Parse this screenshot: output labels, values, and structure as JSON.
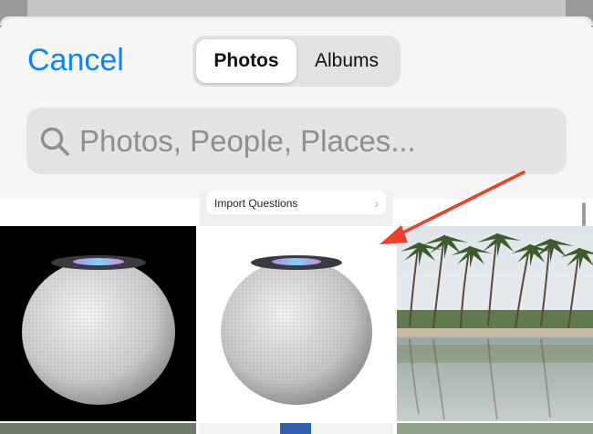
{
  "header": {
    "cancel_label": "Cancel",
    "segments": [
      {
        "label": "Photos",
        "active": true
      },
      {
        "label": "Albums",
        "active": false
      }
    ]
  },
  "search": {
    "placeholder": "Photos, People, Places...",
    "icon": "search-icon"
  },
  "partial_row": {
    "import_label": "Import Questions",
    "import_icon": "chevron-right-icon"
  },
  "grid": {
    "photos": [
      {
        "subject": "homepod-mini-on-black"
      },
      {
        "subject": "homepod-mini-on-white"
      },
      {
        "subject": "palm-trees-by-pond"
      }
    ]
  },
  "annotation": {
    "icon": "red-arrow-pointer",
    "color": "#e8412c"
  },
  "colors": {
    "accent": "#0a84ff",
    "sheet_bg": "#f6f6f7",
    "search_bg": "#e4e4e6"
  }
}
